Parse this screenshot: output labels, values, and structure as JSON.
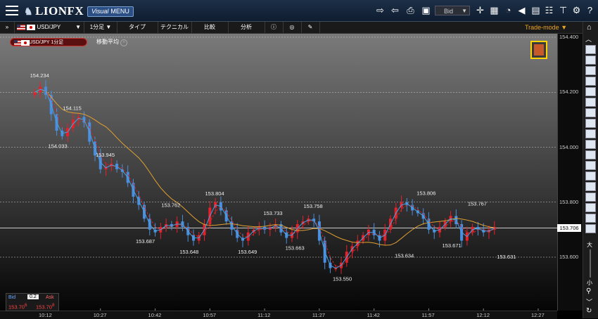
{
  "header": {
    "logo_text": "LIONFX",
    "visual_menu": {
      "prefix": "Visual",
      "label": "MENU"
    },
    "price_type": "Bid"
  },
  "toolbar": {
    "pair": "USD/JPY",
    "timeframe": "1分足",
    "type": "タイプ",
    "technical": "テクニカル",
    "compare": "比較",
    "analysis": "分析",
    "trade_mode": "Trade-mode"
  },
  "chart_header": {
    "pair_period": "USD/JPY 1分足",
    "indicator": "移動平均"
  },
  "chart_data": {
    "type": "candlestick",
    "instrument": "USD/JPY",
    "timeframe": "1 minute",
    "y_ticks": [
      "154.400",
      "154.200",
      "154.000",
      "153.800",
      "153.600"
    ],
    "x_ticks": [
      "10:12",
      "10:27",
      "10:42",
      "10:57",
      "11:12",
      "11:27",
      "11:42",
      "11:57",
      "12:12",
      "12:27"
    ],
    "current_price": "153.706",
    "annotations": [
      {
        "time": "10:10",
        "price": 154.234,
        "label": "154.234"
      },
      {
        "time": "10:15",
        "price": 154.033,
        "label": "154.033"
      },
      {
        "time": "10:19",
        "price": 154.115,
        "label": "154.115"
      },
      {
        "time": "10:28",
        "price": 153.945,
        "label": "153.945"
      },
      {
        "time": "10:39",
        "price": 153.687,
        "label": "153.687"
      },
      {
        "time": "10:46",
        "price": 153.762,
        "label": "153.762"
      },
      {
        "time": "10:51",
        "price": 153.648,
        "label": "153.648"
      },
      {
        "time": "10:58",
        "price": 153.804,
        "label": "153.804"
      },
      {
        "time": "11:07",
        "price": 153.649,
        "label": "153.649"
      },
      {
        "time": "11:14",
        "price": 153.733,
        "label": "153.733"
      },
      {
        "time": "11:20",
        "price": 153.663,
        "label": "153.663"
      },
      {
        "time": "11:25",
        "price": 153.758,
        "label": "153.758"
      },
      {
        "time": "11:33",
        "price": 153.55,
        "label": "153.550"
      },
      {
        "time": "11:50",
        "price": 153.634,
        "label": "153.634"
      },
      {
        "time": "11:56",
        "price": 153.806,
        "label": "153.806"
      },
      {
        "time": "12:03",
        "price": 153.671,
        "label": "153.671"
      },
      {
        "time": "12:10",
        "price": 153.767,
        "label": "153.767"
      },
      {
        "time": "12:18",
        "price": 153.631,
        "label": "153.631"
      }
    ],
    "close_path": [
      [
        0,
        154.2
      ],
      [
        1,
        154.22
      ],
      [
        2,
        154.19
      ],
      [
        3,
        154.12
      ],
      [
        4,
        154.06
      ],
      [
        5,
        154.04
      ],
      [
        6,
        154.07
      ],
      [
        7,
        154.1
      ],
      [
        8,
        154.11
      ],
      [
        9,
        154.09
      ],
      [
        10,
        154.02
      ],
      [
        11,
        153.97
      ],
      [
        12,
        153.92
      ],
      [
        13,
        153.93
      ],
      [
        14,
        153.94
      ],
      [
        15,
        153.92
      ],
      [
        16,
        153.91
      ],
      [
        17,
        153.87
      ],
      [
        18,
        153.82
      ],
      [
        19,
        153.79
      ],
      [
        20,
        153.74
      ],
      [
        21,
        153.7
      ],
      [
        22,
        153.69
      ],
      [
        23,
        153.71
      ],
      [
        24,
        153.72
      ],
      [
        25,
        153.71
      ],
      [
        26,
        153.73
      ],
      [
        27,
        153.71
      ],
      [
        28,
        153.68
      ],
      [
        29,
        153.66
      ],
      [
        30,
        153.68
      ],
      [
        31,
        153.72
      ],
      [
        32,
        153.78
      ],
      [
        33,
        153.8
      ],
      [
        34,
        153.77
      ],
      [
        35,
        153.73
      ],
      [
        36,
        153.7
      ],
      [
        37,
        153.67
      ],
      [
        38,
        153.66
      ],
      [
        39,
        153.69
      ],
      [
        40,
        153.7
      ],
      [
        41,
        153.71
      ],
      [
        42,
        153.7
      ],
      [
        43,
        153.71
      ],
      [
        44,
        153.72
      ],
      [
        45,
        153.69
      ],
      [
        46,
        153.67
      ],
      [
        47,
        153.69
      ],
      [
        48,
        153.72
      ],
      [
        49,
        153.73
      ],
      [
        50,
        153.74
      ],
      [
        51,
        153.73
      ],
      [
        52,
        153.66
      ],
      [
        53,
        153.58
      ],
      [
        54,
        153.56
      ],
      [
        55,
        153.56
      ],
      [
        56,
        153.58
      ],
      [
        57,
        153.62
      ],
      [
        58,
        153.64
      ],
      [
        59,
        153.66
      ],
      [
        60,
        153.68
      ],
      [
        61,
        153.7
      ],
      [
        62,
        153.68
      ],
      [
        63,
        153.66
      ],
      [
        64,
        153.7
      ],
      [
        65,
        153.74
      ],
      [
        66,
        153.78
      ],
      [
        67,
        153.8
      ],
      [
        68,
        153.79
      ],
      [
        69,
        153.77
      ],
      [
        70,
        153.76
      ],
      [
        71,
        153.74
      ],
      [
        72,
        153.7
      ],
      [
        73,
        153.69
      ],
      [
        74,
        153.71
      ],
      [
        75,
        153.73
      ],
      [
        76,
        153.75
      ],
      [
        77,
        153.72
      ],
      [
        78,
        153.66
      ],
      [
        79,
        153.69
      ],
      [
        80,
        153.71
      ],
      [
        81,
        153.7
      ],
      [
        82,
        153.69
      ],
      [
        83,
        153.7
      ],
      [
        84,
        153.71
      ]
    ],
    "colors": {
      "up": "#e8202a",
      "down": "#4a8fdf",
      "ma_short": "#cc2222",
      "ma_long": "#e0a030",
      "ma_mid": "#4aa0e0"
    }
  },
  "bid_ask": {
    "bid_label": "Bid",
    "ask_label": "Ask",
    "spread": "0.2",
    "bid_value": "153.70",
    "bid_suffix": "6",
    "ask_value": "153.70",
    "ask_suffix": "8"
  },
  "sidebar": {
    "zoom_in": "大",
    "zoom_out": "小"
  }
}
